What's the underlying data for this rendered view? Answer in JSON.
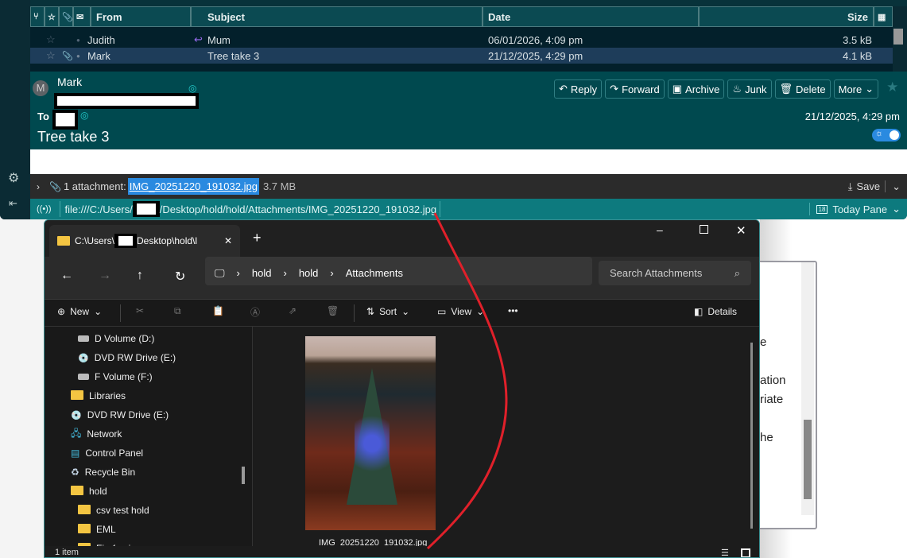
{
  "message_list": {
    "columns": [
      "From",
      "Subject",
      "Date",
      "Size"
    ],
    "rows": [
      {
        "from": "Judith",
        "subject": "Mum",
        "date": "06/01/2026, 4:09 pm",
        "size": "3.5 kB",
        "replied": true,
        "selected": false
      },
      {
        "from": "Mark",
        "subject": "Tree take 3",
        "date": "21/12/2025, 4:29 pm",
        "size": "4.1 kB",
        "attachment": true,
        "selected": true
      }
    ]
  },
  "message": {
    "avatar_letter": "M",
    "from_name": "Mark",
    "to_label": "To",
    "subject": "Tree take 3",
    "date": "21/12/2025, 4:29 pm",
    "actions": [
      "Reply",
      "Forward",
      "Archive",
      "Junk",
      "Delete",
      "More"
    ]
  },
  "attachments": {
    "count_label": "1 attachment:",
    "filename": "IMG_20251220_191032.jpg",
    "size": "3.7 MB",
    "save_label": "Save"
  },
  "statusbar": {
    "url_prefix": "file:///C:/Users/",
    "url_suffix": "/Desktop/hold/hold/Attachments/IMG_20251220_191032.jpg",
    "today_pane": "Today Pane",
    "calendar_day": "18"
  },
  "explorer": {
    "tab_title_prefix": "C:\\Users\\",
    "tab_title_suffix": "Desktop\\hold\\l",
    "breadcrumb": [
      "hold",
      "hold",
      "Attachments"
    ],
    "search_placeholder": "Search Attachments",
    "toolbar": {
      "new": "New",
      "sort": "Sort",
      "view": "View",
      "more": "•••",
      "details": "Details"
    },
    "tree": [
      {
        "label": "D Volume (D:)",
        "icon": "drive",
        "indent": 2
      },
      {
        "label": "DVD RW Drive (E:)",
        "icon": "dvd",
        "indent": 2
      },
      {
        "label": "F Volume (F:)",
        "icon": "drive",
        "indent": 2
      },
      {
        "label": "Libraries",
        "icon": "folder",
        "indent": 1
      },
      {
        "label": "DVD RW Drive (E:)",
        "icon": "dvd",
        "indent": 1
      },
      {
        "label": "Network",
        "icon": "network",
        "indent": 1
      },
      {
        "label": "Control Panel",
        "icon": "control-panel",
        "indent": 1
      },
      {
        "label": "Recycle Bin",
        "icon": "recycle-bin",
        "indent": 1
      },
      {
        "label": "hold",
        "icon": "folder",
        "indent": 1
      },
      {
        "label": "csv test hold",
        "icon": "folder",
        "indent": 2
      },
      {
        "label": "EML",
        "icon": "folder",
        "indent": 2
      },
      {
        "label": "Firefox-icons",
        "icon": "folder",
        "indent": 2
      }
    ],
    "file": {
      "name": "IMG_20251220_191032.jpg"
    },
    "status": "1 item"
  },
  "background_text": [
    "e",
    "ation",
    "riate",
    "he"
  ],
  "colors": {
    "teal": "#00494f",
    "status_teal": "#0d7a7e",
    "selection": "#1e3d5a",
    "highlight": "#2a8ae0",
    "annotation_red": "#e0202a"
  }
}
